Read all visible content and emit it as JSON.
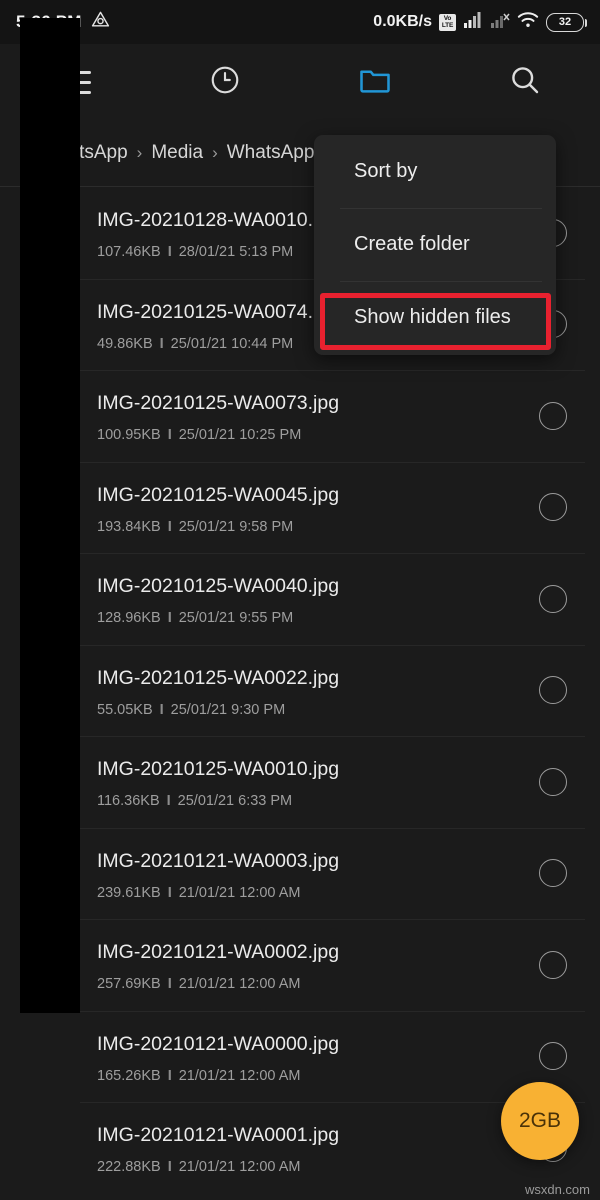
{
  "status_bar": {
    "clock": "5:36 PM",
    "drive_icon": "triangle-cloud-icon",
    "net_speed": "0.0KB/s",
    "volte_label_top": "Vo",
    "volte_label_bottom": "LTE",
    "signal_icon_1": "signal-bars-icon",
    "signal_icon_2": "signal-bars-no-sim-icon",
    "wifi_icon": "wifi-icon",
    "battery_level": "32"
  },
  "toolbar": {
    "menu_icon": "hamburger-menu-icon",
    "recent_icon": "clock-icon",
    "folder_icon": "folder-icon",
    "search_icon": "search-icon",
    "folder_active_color": "#2196d6"
  },
  "breadcrumb": {
    "segments": [
      "WhatsApp",
      "Media",
      "WhatsApp"
    ],
    "separator": "›"
  },
  "popup_menu": {
    "items": [
      {
        "label": "Sort by"
      },
      {
        "label": "Create folder"
      },
      {
        "label": "Show hidden files"
      }
    ],
    "highlighted_index": 2,
    "highlight_color": "#e8212f"
  },
  "files": [
    {
      "name": "IMG-20210128-WA0010.",
      "size": "107.46KB",
      "date": "28/01/21 5:13 PM"
    },
    {
      "name": "IMG-20210125-WA0074.",
      "size": "49.86KB",
      "date": "25/01/21 10:44 PM"
    },
    {
      "name": "IMG-20210125-WA0073.jpg",
      "size": "100.95KB",
      "date": "25/01/21 10:25 PM"
    },
    {
      "name": "IMG-20210125-WA0045.jpg",
      "size": "193.84KB",
      "date": "25/01/21 9:58 PM"
    },
    {
      "name": "IMG-20210125-WA0040.jpg",
      "size": "128.96KB",
      "date": "25/01/21 9:55 PM"
    },
    {
      "name": "IMG-20210125-WA0022.jpg",
      "size": "55.05KB",
      "date": "25/01/21 9:30 PM"
    },
    {
      "name": "IMG-20210125-WA0010.jpg",
      "size": "116.36KB",
      "date": "25/01/21 6:33 PM"
    },
    {
      "name": "IMG-20210121-WA0003.jpg",
      "size": "239.61KB",
      "date": "21/01/21 12:00 AM"
    },
    {
      "name": "IMG-20210121-WA0002.jpg",
      "size": "257.69KB",
      "date": "21/01/21 12:00 AM"
    },
    {
      "name": "IMG-20210121-WA0000.jpg",
      "size": "165.26KB",
      "date": "21/01/21 12:00 AM"
    },
    {
      "name": "IMG-20210121-WA0001.jpg",
      "size": "222.88KB",
      "date": "21/01/21 12:00 AM"
    }
  ],
  "meta_separator": "I",
  "fab": {
    "label": "2GB",
    "color": "#f8b133"
  },
  "watermark": {
    "text": "wsxdn.com"
  }
}
